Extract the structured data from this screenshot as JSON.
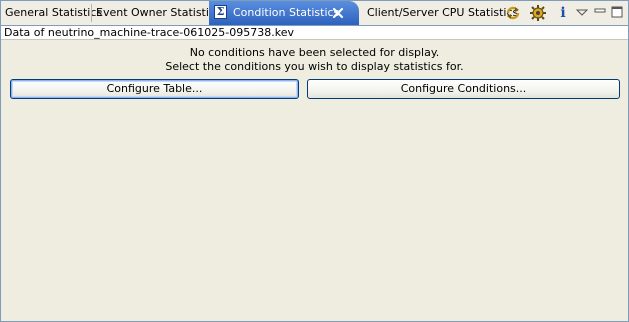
{
  "tabs": [
    {
      "label": "General Statistics",
      "active": false
    },
    {
      "label": "Event Owner Statistics",
      "active": false
    },
    {
      "label": "Condition Statistics",
      "active": true,
      "icon": "sigma-icon",
      "icon_glyph": "Σ"
    },
    {
      "label": "Client/Server CPU Statistics",
      "active": false
    }
  ],
  "toolbar": {
    "icons": [
      "refresh-icon",
      "settings-gear-icon",
      "info-icon",
      "view-menu-icon",
      "minimize-icon",
      "maximize-icon"
    ],
    "info_glyph": "i"
  },
  "subtitle": "Data of neutrino_machine-trace-061025-095738.kev",
  "message": {
    "line1": "No conditions have been selected for display.",
    "line2": "Select the conditions you wish to display statistics for."
  },
  "buttons": {
    "configure_table": "Configure Table...",
    "configure_conditions": "Configure Conditions..."
  },
  "colors": {
    "active_tab": "#3a72c9",
    "background": "#efede0",
    "border": "#7f9db9",
    "button_border": "#003c74"
  }
}
